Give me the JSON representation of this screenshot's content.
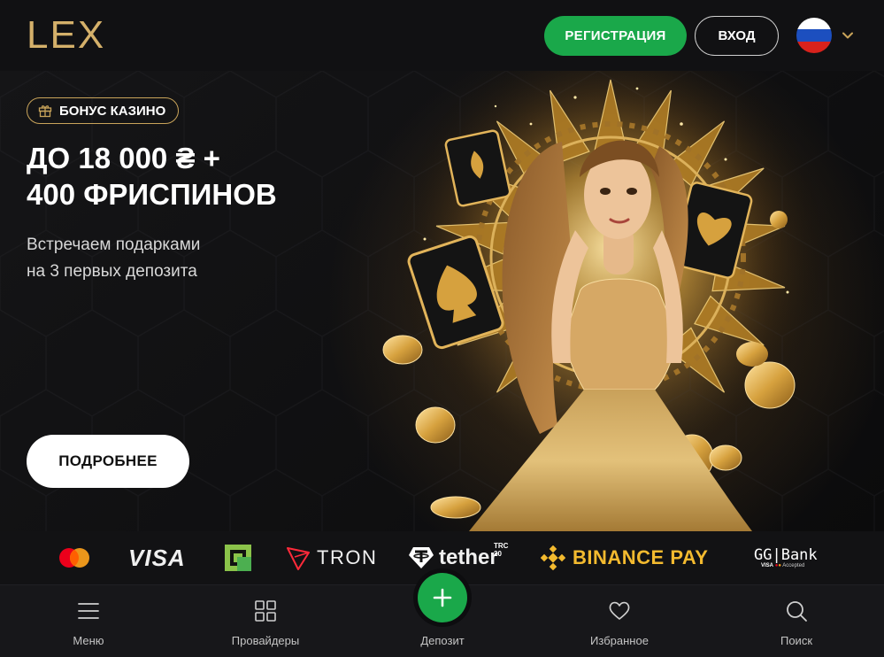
{
  "header": {
    "logo": "LEX",
    "register_label": "РЕГИСТРАЦИЯ",
    "login_label": "ВХОД",
    "language": "Русский",
    "language_icon": "russia-flag-icon"
  },
  "hero": {
    "badge_label": "БОНУС КАЗИНО",
    "badge_icon": "gift-icon",
    "title_line1": "ДО 18 000 ₴ +",
    "title_line2": "400 ФРИСПИНОВ",
    "subtitle_line1": "Встречаем подарками",
    "subtitle_line2": "на 3 первых депозита",
    "more_label": "ПОДРОБНЕЕ"
  },
  "payments": {
    "methods": [
      {
        "name": "mastercard",
        "icon": "mastercard-icon"
      },
      {
        "name": "VISA",
        "icon": "visa-logo"
      },
      {
        "name": "privatbank",
        "icon": "privatbank-icon"
      },
      {
        "name": "TRON",
        "icon": "tron-icon"
      },
      {
        "name": "tether",
        "badge": "TRC 20",
        "icon": "tether-icon"
      },
      {
        "name": "BINANCE PAY",
        "icon": "binance-icon"
      },
      {
        "name": "GG|Bank",
        "sub": "Accepted",
        "icon": "ggbank-logo"
      }
    ]
  },
  "nav": {
    "items": [
      {
        "label": "Меню",
        "icon": "menu-icon"
      },
      {
        "label": "Провайдеры",
        "icon": "grid-icon"
      },
      {
        "label": "Депозит",
        "icon": "plus-icon"
      },
      {
        "label": "Избранное",
        "icon": "heart-icon"
      },
      {
        "label": "Поиск",
        "icon": "search-icon"
      }
    ]
  },
  "colors": {
    "accent_green": "#1aa84a",
    "gold": "#d4b06a",
    "background": "#0d0d0f"
  }
}
